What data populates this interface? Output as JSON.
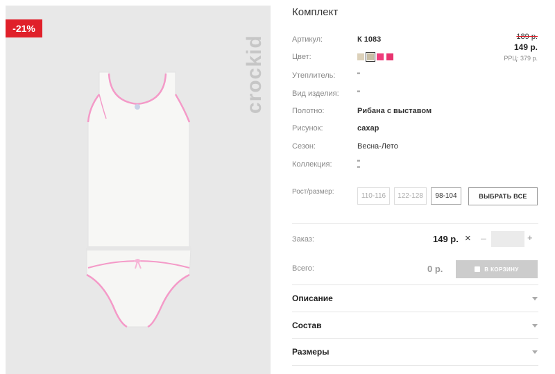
{
  "product": {
    "title": "Комплект",
    "discount_badge": "-21%",
    "brand": "crockid",
    "attributes": [
      {
        "label": "Артикул:",
        "value": "К 1083"
      },
      {
        "label": "Цвет:",
        "value": ""
      },
      {
        "label": "Утеплитель:",
        "value": "\""
      },
      {
        "label": "Вид изделия:",
        "value": "\""
      },
      {
        "label": "Полотно:",
        "value": "Рибана с выставом"
      },
      {
        "label": "Рисунок:",
        "value": "сахар"
      },
      {
        "label": "Сезон:",
        "value": "Весна-Лето"
      },
      {
        "label": "Коллекция:",
        "value": "\"\n\""
      }
    ],
    "colors": [
      "#dcd1ba",
      "#c9bfa6",
      "#ef3d7c",
      "#e8336f"
    ],
    "price": {
      "old": "189 р.",
      "current": "149 р.",
      "rrc": "РРЦ: 379 р."
    },
    "sizes": {
      "label": "Рост/размер:",
      "options": [
        "110-116",
        "122-128",
        "98-104"
      ],
      "selected": "98-104",
      "select_all_label": "ВЫБРАТЬ ВСЕ"
    }
  },
  "order": {
    "label": "Заказ:",
    "unit_price": "149 р.",
    "times": "×",
    "minus": "–",
    "plus": "+",
    "quantity": ""
  },
  "total": {
    "label": "Всего:",
    "value": "0 р.",
    "cart_button": "В КОРЗИНУ"
  },
  "accordion": [
    {
      "label": "Описание"
    },
    {
      "label": "Состав"
    },
    {
      "label": "Размеры"
    }
  ]
}
